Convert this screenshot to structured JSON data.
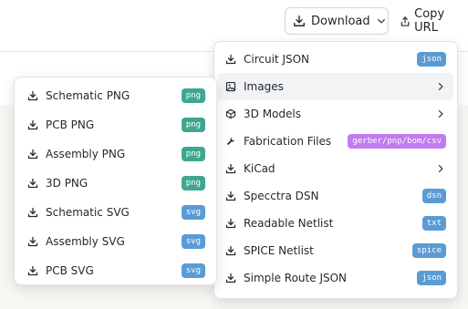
{
  "toolbar": {
    "download_label": "Download",
    "copy_url_label": "Copy URL"
  },
  "download_menu": {
    "items": [
      {
        "label": "Circuit JSON",
        "badge": "json",
        "badge_color": "#5b9bd5",
        "icon": "download-icon"
      },
      {
        "label": "Images",
        "icon": "image-icon",
        "submenu": true
      },
      {
        "label": "3D Models",
        "icon": "cube-icon",
        "submenu": true
      },
      {
        "label": "Fabrication Files",
        "badge": "gerber/pnp/bom/csv",
        "badge_color": "#c27af0",
        "icon": "wrench-icon"
      },
      {
        "label": "KiCad",
        "icon": "download-icon",
        "submenu": true
      },
      {
        "label": "Specctra DSN",
        "badge": "dsn",
        "badge_color": "#5b9bd5",
        "icon": "download-icon"
      },
      {
        "label": "Readable Netlist",
        "badge": "txt",
        "badge_color": "#5b9bd5",
        "icon": "download-icon"
      },
      {
        "label": "SPICE Netlist",
        "badge": "spice",
        "badge_color": "#5b9bd5",
        "icon": "download-icon"
      },
      {
        "label": "Simple Route JSON",
        "badge": "json",
        "badge_color": "#5b9bd5",
        "icon": "download-icon"
      }
    ]
  },
  "images_submenu": {
    "items": [
      {
        "label": "Schematic PNG",
        "badge": "png",
        "badge_color": "#3fa78f"
      },
      {
        "label": "PCB PNG",
        "badge": "png",
        "badge_color": "#3fa78f"
      },
      {
        "label": "Assembly PNG",
        "badge": "png",
        "badge_color": "#3fa78f"
      },
      {
        "label": "3D PNG",
        "badge": "png",
        "badge_color": "#3fa78f"
      },
      {
        "label": "Schematic SVG",
        "badge": "svg",
        "badge_color": "#5b9bd5"
      },
      {
        "label": "Assembly SVG",
        "badge": "svg",
        "badge_color": "#5b9bd5"
      },
      {
        "label": "PCB SVG",
        "badge": "svg",
        "badge_color": "#5b9bd5"
      }
    ]
  }
}
